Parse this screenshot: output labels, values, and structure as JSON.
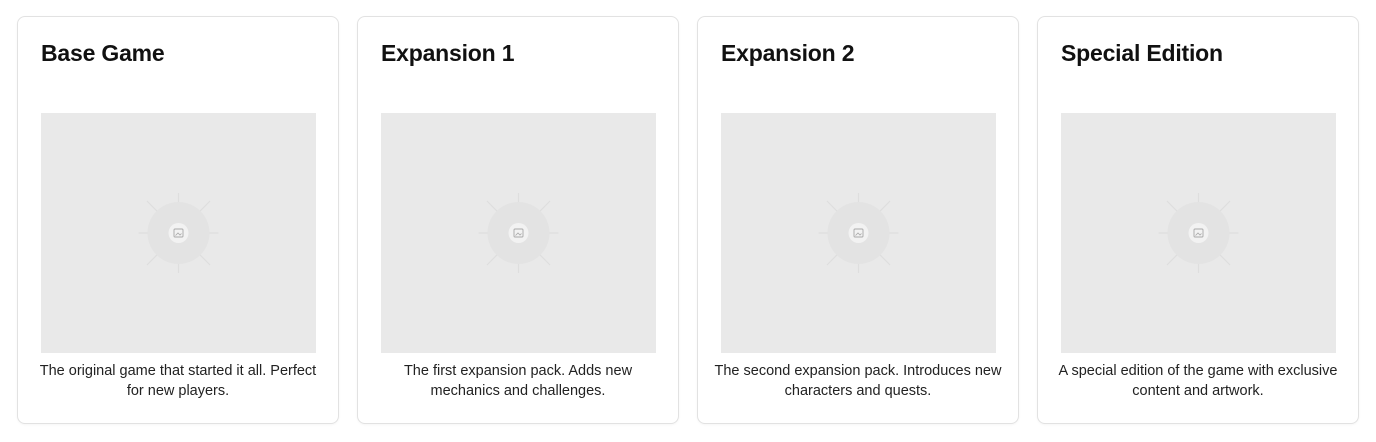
{
  "cards": [
    {
      "title": "Base Game",
      "image_icon": "image-placeholder-icon",
      "description": "The original game that started it all. Perfect for new players."
    },
    {
      "title": "Expansion 1",
      "image_icon": "image-placeholder-icon",
      "description": "The first expansion pack. Adds new mechanics and challenges."
    },
    {
      "title": "Expansion 2",
      "image_icon": "image-placeholder-icon",
      "description": "The second expansion pack. Introduces new characters and quests."
    },
    {
      "title": "Special Edition",
      "image_icon": "image-placeholder-icon",
      "description": "A special edition of the game with exclusive content and artwork."
    }
  ],
  "colors": {
    "card_border": "#e2e2e2",
    "placeholder_bg": "#e9e9e9",
    "title_text": "#111111",
    "body_text": "#222222"
  }
}
